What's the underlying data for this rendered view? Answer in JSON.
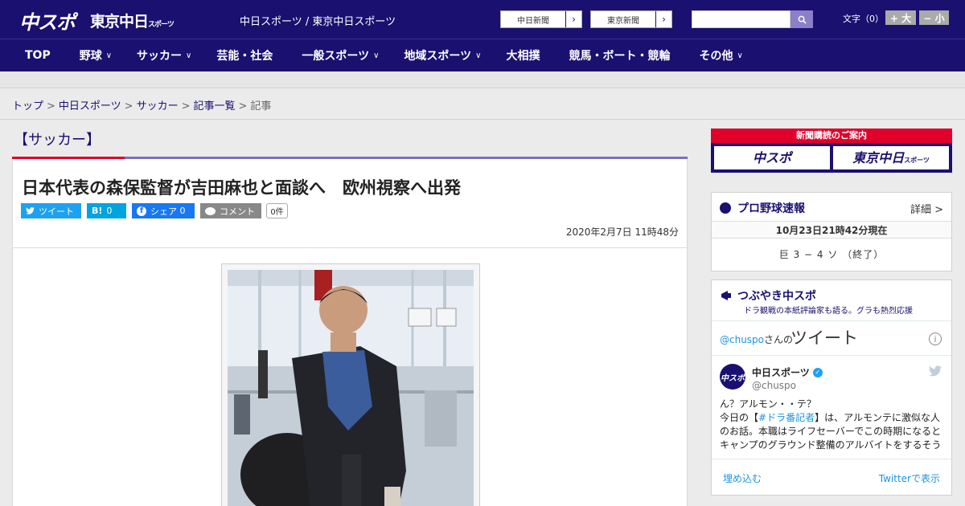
{
  "header": {
    "logo_chuspo": "中スポ",
    "logo_tokyo": "東京中日",
    "logo_tokyo_small": "スポーツ",
    "site_name": "中日スポーツ / 東京中日スポーツ",
    "ext_links": [
      {
        "label": "中日新聞",
        "arrow": "›"
      },
      {
        "label": "東京新聞",
        "arrow": "›"
      }
    ],
    "search_placeholder": "",
    "fontsize_label": "文字（0）",
    "fontsize_up": "+ 大",
    "fontsize_down": "− 小"
  },
  "nav": [
    {
      "label": "TOP",
      "chev": ""
    },
    {
      "label": "野球",
      "chev": "∨"
    },
    {
      "label": "サッカー",
      "chev": "∨"
    },
    {
      "label": "芸能・社会",
      "chev": ""
    },
    {
      "label": "一般スポーツ",
      "chev": "∨"
    },
    {
      "label": "地域スポーツ",
      "chev": "∨"
    },
    {
      "label": "大相撲",
      "chev": ""
    },
    {
      "label": "競馬・ボート・競輪",
      "chev": ""
    },
    {
      "label": "その他",
      "chev": "∨"
    }
  ],
  "breadcrumb": {
    "items": [
      "トップ",
      "中日スポーツ",
      "サッカー",
      "記事一覧"
    ],
    "current": "記事",
    "sep": ">"
  },
  "article": {
    "category": "【サッカー】",
    "title": "日本代表の森保監督が吉田麻也と面談へ　欧州視察へ出発",
    "share": {
      "tweet": "ツイート",
      "hatena_icon": "B!",
      "hatena_count": "0",
      "facebook": "シェア",
      "facebook_count": "0",
      "comment": "コメント",
      "comment_count": "0件"
    },
    "date": "2020年2月7日 11時48分"
  },
  "sidebar": {
    "banner_top": "新聞購読のご案内",
    "banner_left": "中スポ",
    "banner_right": "東京中日",
    "banner_right_small": "スポーツ",
    "baseball": {
      "title": "プロ野球速報",
      "detail": "詳細 >",
      "date": "10月23日21時42分現在",
      "score": "巨 3 − 4 ソ （終了）"
    },
    "tweets": {
      "title": "つぶやき中スポ",
      "subtitle": "ドラ観戦の本紙評論家も語る。グラも熱烈応援",
      "by_handle": "@chuspo",
      "by_suffix": "さんの",
      "heading": "ツイート",
      "info": "i",
      "avatar": "中スポ",
      "name": "中日スポーツ",
      "verified": "✓",
      "at": "@chuspo",
      "line1": "ん？アルモン・・テ？",
      "line2_pre": "今日の【",
      "line2_tag": "#ドラ番記者",
      "line2_post": "】は、アルモンテに激似な人のお話。本職はライフセーバーでこの時期になるとキャンプのグラウンド整備のアルバイトをするそう",
      "embed": "埋め込む",
      "view": "Twitterで表示"
    }
  },
  "colors": {
    "brand_navy": "#1a1070",
    "accent_red": "#e0002a",
    "twitter_blue": "#1da1f2",
    "facebook_blue": "#1877f2",
    "hatena_blue": "#00a4de"
  }
}
